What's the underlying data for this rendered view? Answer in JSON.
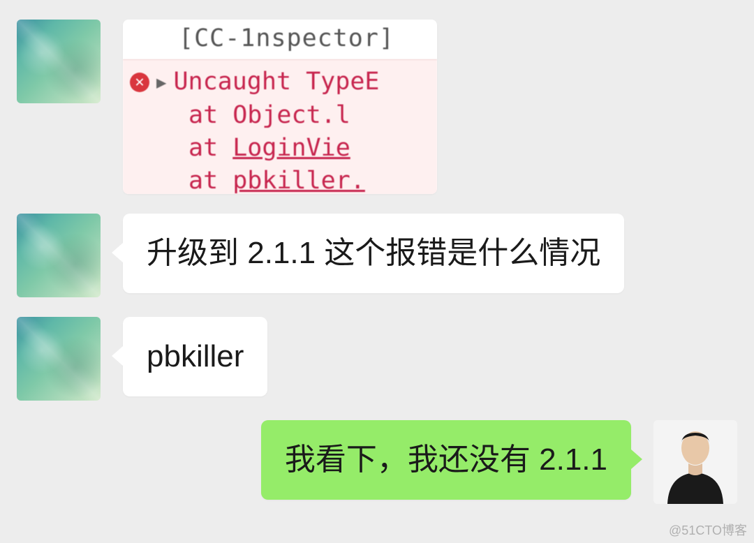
{
  "messages": {
    "msg1_image": {
      "console_line1": "[CC-1nspector] ",
      "error_title": "Uncaught TypeE",
      "stack_line1_at": "at ",
      "stack_line1_loc": "Object.l",
      "stack_line2_at": "at ",
      "stack_line2_loc": "LoginVie",
      "stack_line3_at": "at ",
      "stack_line3_loc": "pbkiller."
    },
    "msg2_text": "升级到 2.1.1 这个报错是什么情况",
    "msg3_text": "pbkiller",
    "msg4_text": "我看下，我还没有 2.1.1"
  },
  "watermark": "@51CTO博客"
}
